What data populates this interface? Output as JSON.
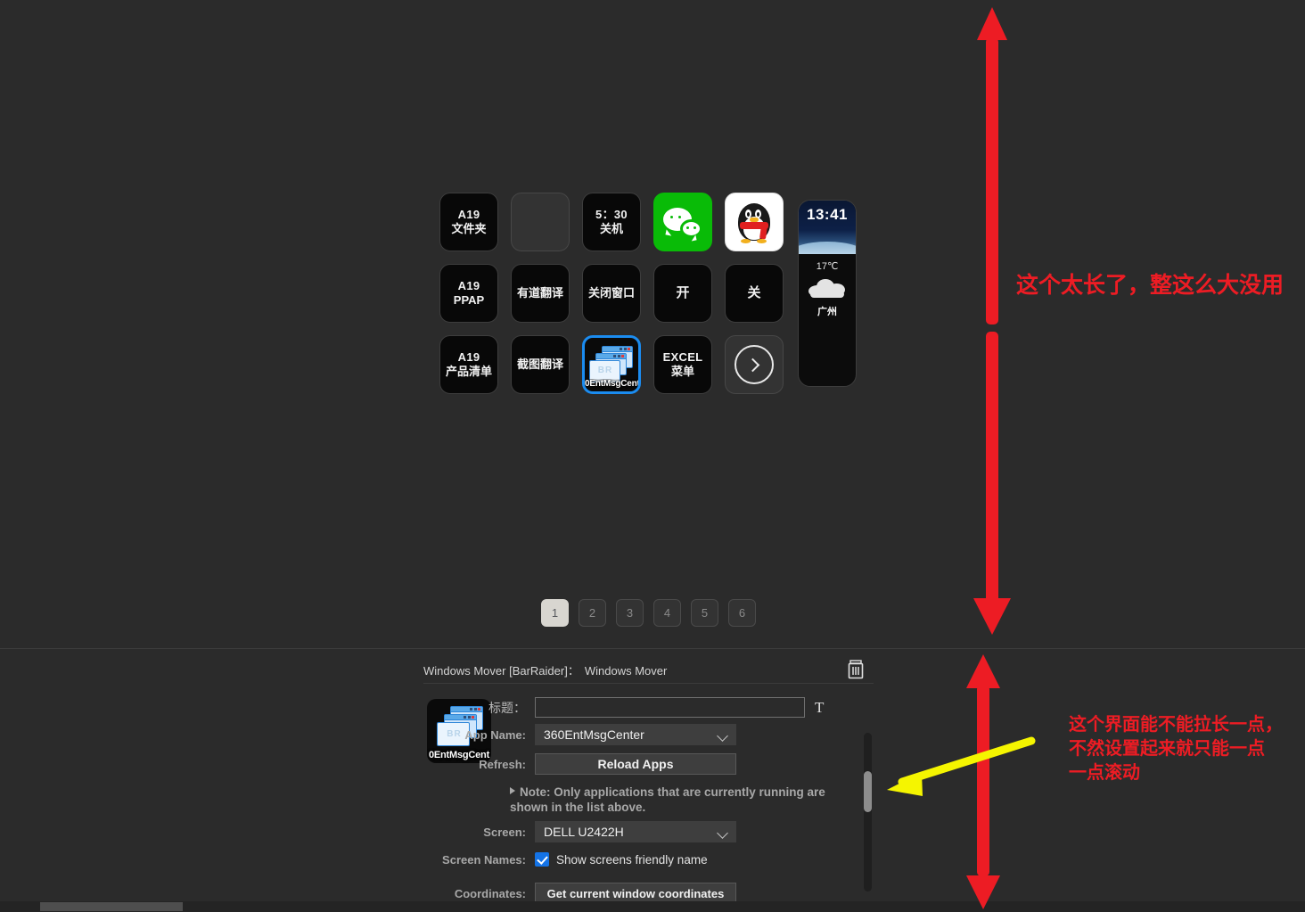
{
  "deck": {
    "keys": [
      {
        "id": "a19-folder",
        "type": "text2",
        "line1": "A19",
        "line2": "文件夹"
      },
      {
        "id": "empty-slot",
        "type": "empty",
        "line1": "",
        "line2": ""
      },
      {
        "id": "shutdown-530",
        "type": "text2",
        "line1": "5：30",
        "line2": "关机"
      },
      {
        "id": "wechat",
        "type": "wechat",
        "line1": "",
        "line2": ""
      },
      {
        "id": "qq",
        "type": "qq",
        "line1": "",
        "line2": ""
      },
      {
        "id": "a19-ppap",
        "type": "text2",
        "line1": "A19",
        "line2": "PPAP"
      },
      {
        "id": "youdao-translate",
        "type": "cn",
        "line1": "有道翻译",
        "line2": ""
      },
      {
        "id": "close-window",
        "type": "cn",
        "line1": "关闭窗口",
        "line2": ""
      },
      {
        "id": "on",
        "type": "single",
        "line1": "开",
        "line2": ""
      },
      {
        "id": "off",
        "type": "single",
        "line1": "关",
        "line2": ""
      },
      {
        "id": "a19-product-list",
        "type": "text2",
        "line1": "A19",
        "line2": "产品清单"
      },
      {
        "id": "screenshot-translate",
        "type": "cn",
        "line1": "截图翻译",
        "line2": ""
      },
      {
        "id": "windows-mover-selected",
        "type": "selected",
        "line1": "",
        "line2": "",
        "caption": "0EntMsgCent"
      },
      {
        "id": "excel-menu",
        "type": "text2",
        "line1": "EXCEL",
        "line2": "菜单"
      },
      {
        "id": "next-page",
        "type": "arrow",
        "line1": "",
        "line2": ""
      }
    ],
    "weather": {
      "time": "13:41",
      "temperature": "17℃",
      "city": "广州"
    },
    "pagination": {
      "pages": [
        "1",
        "2",
        "3",
        "4",
        "5",
        "6"
      ],
      "active": "1"
    }
  },
  "settings": {
    "plugin_name": "Windows Mover [BarRaider]",
    "separator": "：",
    "action_name": "Windows Mover",
    "delete_icon": "trash-icon",
    "app_icon_caption": "0EntMsgCent",
    "rows": {
      "title_label": "标题：",
      "title_value": "",
      "title_placeholder": "",
      "text_tool_label": "T",
      "app_name_label": "App Name:",
      "app_name_value": "360EntMsgCenter",
      "refresh_label": "Refresh:",
      "reload_apps_label": "Reload Apps",
      "note_text": "Note: Only applications that are currently running are shown in the list above.",
      "screen_label": "Screen:",
      "screen_value": "DELL U2422H",
      "screen_names_label": "Screen Names:",
      "screen_names_checkbox_label": "Show screens friendly name",
      "screen_names_checked": true,
      "coordinates_label": "Coordinates:",
      "coordinates_button_label": "Get current window coordinates"
    }
  },
  "annotations": {
    "note_top": "这个太长了，整这么大没用",
    "note_bottom": "这个界面能不能拉长一点，\n不然设置起来就只能一点\n一点滚动",
    "arrow_color_red": "#ED1C24",
    "arrow_color_yellow": "#F5F500"
  }
}
